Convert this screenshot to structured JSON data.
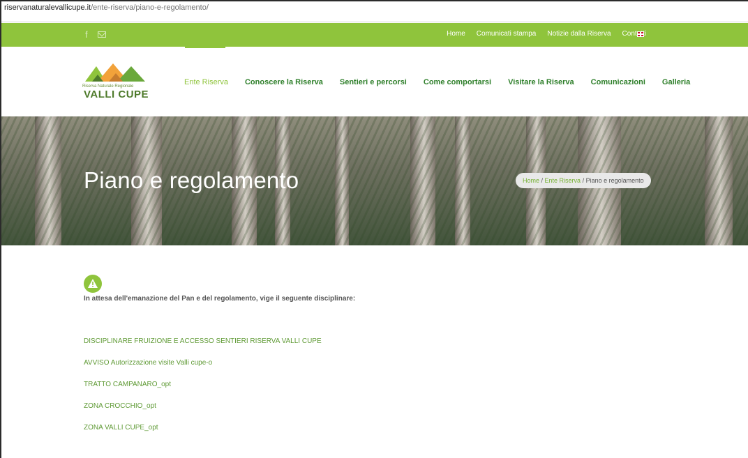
{
  "browser": {
    "url_host": "riservanaturalevallicupe.it",
    "url_path": "/ente-riserva/piano-e-regolamento/"
  },
  "topbar": {
    "social": [
      {
        "name": "facebook-icon",
        "glyph": "f"
      }
    ],
    "nav": [
      "Home",
      "Comunicati stampa",
      "Notizie dalla Riserva",
      "Contatti"
    ],
    "flag_icon": "uk-flag-icon"
  },
  "logo": {
    "subtitle": "Riserva Naturale Regionale",
    "title": "VALLI CUPE"
  },
  "main_nav": [
    {
      "label": "Ente Riserva",
      "active": true
    },
    {
      "label": "Conoscere la Riserva",
      "active": false
    },
    {
      "label": "Sentieri e percorsi",
      "active": false
    },
    {
      "label": "Come comportarsi",
      "active": false
    },
    {
      "label": "Visitare la Riserva",
      "active": false
    },
    {
      "label": "Comunicazioni",
      "active": false
    },
    {
      "label": "Galleria",
      "active": false
    }
  ],
  "hero": {
    "title": "Piano e regolamento",
    "breadcrumb": [
      "Home",
      "Ente Riserva",
      "Piano e regolamento"
    ]
  },
  "content": {
    "intro": "In attesa dell'emanazione del Pan e del regolamento, vige il seguente disciplinare:",
    "links": [
      "DISCIPLINARE FRUIZIONE E ACCESSO SENTIERI RISERVA VALLI CUPE",
      "AVVISO Autorizzazione visite Valli cupe-o",
      "TRATTO CAMPANARO_opt",
      "ZONA CROCCHIO_opt",
      "ZONA VALLI CUPE_opt"
    ]
  },
  "colors": {
    "accent_green": "#8fc43c",
    "nav_green": "#2e7f2a",
    "link_green": "#5f9a35"
  }
}
